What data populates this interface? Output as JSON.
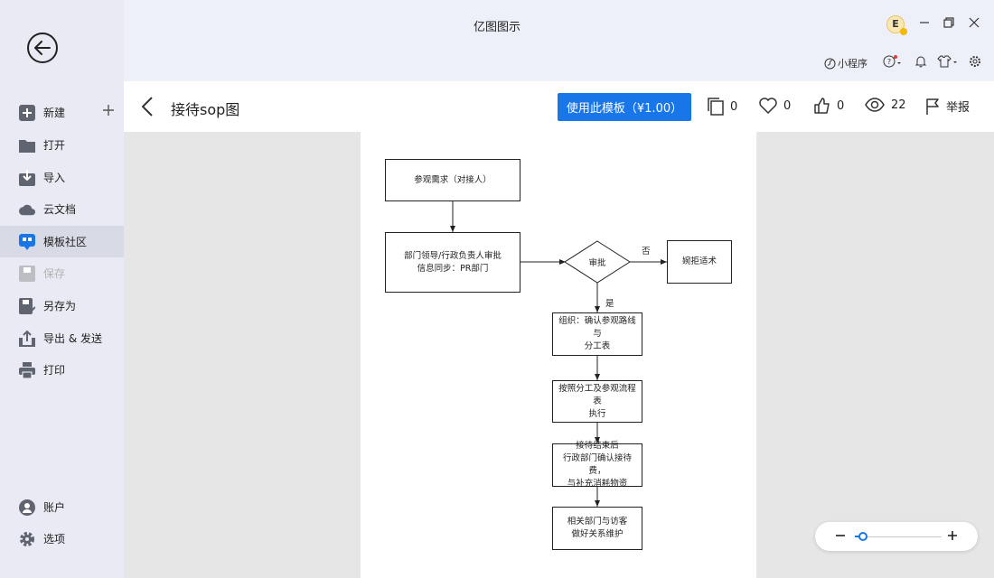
{
  "app": {
    "title": "亿图图示"
  },
  "user": {
    "avatar_letter": "E"
  },
  "toolbar": {
    "mini_program_label": "小程序"
  },
  "sidebar": {
    "items": [
      {
        "label": "新建",
        "icon": "plus-square-icon"
      },
      {
        "label": "打开",
        "icon": "folder-icon"
      },
      {
        "label": "导入",
        "icon": "import-icon"
      },
      {
        "label": "云文档",
        "icon": "cloud-icon"
      },
      {
        "label": "模板社区",
        "icon": "community-icon",
        "active": true
      },
      {
        "label": "保存",
        "icon": "save-icon",
        "disabled": true
      },
      {
        "label": "另存为",
        "icon": "save-as-icon"
      },
      {
        "label": "导出 & 发送",
        "icon": "export-icon"
      },
      {
        "label": "打印",
        "icon": "print-icon"
      }
    ],
    "bottom": [
      {
        "label": "账户",
        "icon": "account-icon"
      },
      {
        "label": "选项",
        "icon": "settings-icon"
      }
    ]
  },
  "template": {
    "title": "接待sop图",
    "use_button": "使用此模板（¥1.00）",
    "copies": "0",
    "favorites": "0",
    "likes": "0",
    "views": "22",
    "report_label": "举报"
  },
  "flowchart": {
    "nodes": {
      "n1": "参观需求（对接人）",
      "n2": "部门领导/行政负责人审批\n信息同步：PR部门",
      "decision": "审批",
      "reject": "婉拒适术",
      "n3": "组织：确认参观路线与\n分工表",
      "n4": "按照分工及参观流程表\n执行",
      "n5": "接待结束后\n行政部门确认接待费，\n与补充消耗物资",
      "n6": "相关部门与访客\n做好关系维护"
    },
    "labels": {
      "no": "否",
      "yes": "是"
    }
  },
  "colors": {
    "accent": "#1976e9",
    "sidebar_bg": "#e9eaf3",
    "canvas_bg": "#e6e6e6"
  }
}
